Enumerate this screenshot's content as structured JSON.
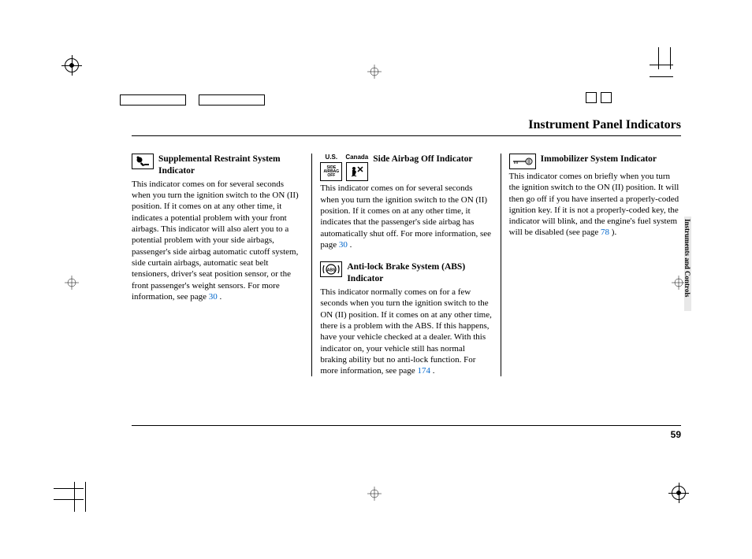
{
  "header": {
    "title": "Instrument Panel Indicators"
  },
  "side_tab": "Instruments and Controls",
  "page_number": "59",
  "col1": {
    "srs": {
      "title": "Supplemental Restraint System Indicator",
      "body_a": "This indicator comes on for several seconds when you turn the ignition switch to the ON (II) position. If it comes on at any other time, it indicates a potential problem with your front airbags. This indicator will also alert you to a potential problem with your side airbags, passenger's side airbag automatic cutoff system, side curtain airbags, automatic seat belt tensioners, driver's seat position sensor, or the front passenger's weight sensors. For more information, see page ",
      "page_link": "30",
      "body_b": " ."
    }
  },
  "col2": {
    "icon_labels": {
      "us": "U.S.",
      "canada": "Canada",
      "side_text": "SIDE\nAIRBAG\nOFF"
    },
    "side_airbag": {
      "title": "Side Airbag Off Indicator",
      "body_a": "This indicator comes on for several seconds when you turn the ignition switch to the ON (II) position. If it comes on at any other time, it indicates that the passenger's side airbag has automatically shut off. For more information, see page ",
      "page_link": "30",
      "body_b": " ."
    },
    "abs": {
      "title": "Anti-lock Brake System (ABS) Indicator",
      "body_a": "This indicator normally comes on for a few seconds when you turn the ignition switch to the ON (II) position. If it comes on at any other time, there is a problem with the ABS. If this happens, have your vehicle checked at a dealer. With this indicator on, your vehicle still has normal braking ability but no anti-lock function. For more information, see page ",
      "page_link": "174",
      "body_b": " ."
    }
  },
  "col3": {
    "immobilizer": {
      "title": "Immobilizer System Indicator",
      "body_a": "This indicator comes on briefly when you turn the ignition switch to the ON (II) position. It will then go off if you have inserted a properly-coded ignition key. If it is not a properly-coded key, the indicator will blink, and the engine's fuel system will be disabled (see page ",
      "page_link": "78",
      "body_b": " )."
    }
  }
}
